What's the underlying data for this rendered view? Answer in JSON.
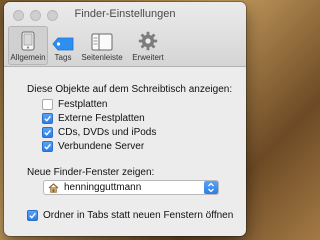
{
  "window": {
    "title": "Finder-Einstellungen"
  },
  "toolbar": {
    "items": [
      {
        "label": "Allgemein",
        "icon": "phone-device-icon",
        "active": true
      },
      {
        "label": "Tags",
        "icon": "tag-icon",
        "active": false
      },
      {
        "label": "Seitenleiste",
        "icon": "sidebar-icon",
        "active": false
      },
      {
        "label": "Erweitert",
        "icon": "gear-icon",
        "active": false
      }
    ]
  },
  "desktop_section": {
    "heading": "Diese Objekte auf dem Schreibtisch anzeigen:",
    "items": [
      {
        "label": "Festplatten",
        "checked": false
      },
      {
        "label": "Externe Festplatten",
        "checked": true
      },
      {
        "label": "CDs, DVDs und iPods",
        "checked": true
      },
      {
        "label": "Verbundene Server",
        "checked": true
      }
    ]
  },
  "new_window_section": {
    "heading": "Neue Finder-Fenster zeigen:",
    "selected": "henningguttmann",
    "selected_icon": "home-icon"
  },
  "tabs_option": {
    "label": "Ordner in Tabs statt neuen Fenstern öffnen",
    "checked": true
  },
  "colors": {
    "accent": "#2d7de8",
    "tag_blue": "#2f8ff0"
  }
}
